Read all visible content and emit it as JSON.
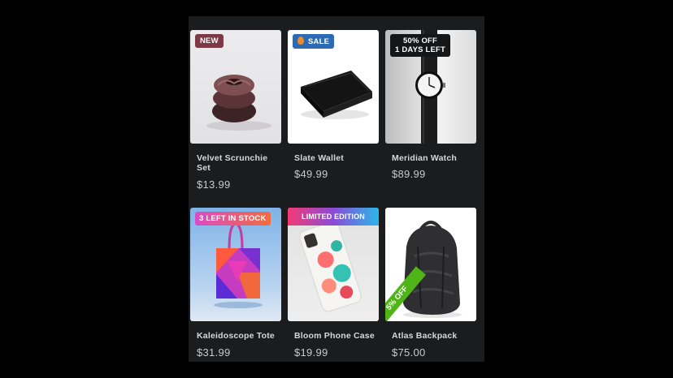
{
  "products": [
    {
      "name": "Velvet Scrunchie Set",
      "price": "$13.99",
      "badge": "NEW"
    },
    {
      "name": "Slate Wallet",
      "price": "$49.99",
      "badge": "SALE"
    },
    {
      "name": "Meridian Watch",
      "price": "$89.99",
      "badge_line1": "50% OFF",
      "badge_line2": "1 DAYS LEFT"
    },
    {
      "name": "Kaleidoscope Tote",
      "price": "$31.99",
      "badge": "3 LEFT IN STOCK"
    },
    {
      "name": "Bloom Phone Case",
      "price": "$19.99",
      "badge": "LIMITED EDITION"
    },
    {
      "name": "Atlas Backpack",
      "price": "$75.00",
      "badge": "5% OFF"
    }
  ],
  "icons": {
    "sale_badge_icon": "flame-icon"
  },
  "colors": {
    "panel_bg": "#1b1c1e",
    "badge_new": "#7b3a45",
    "badge_sale": "#2c6ab3",
    "badge_timer": "#141618",
    "badge_ribbon": "#4fb516"
  }
}
